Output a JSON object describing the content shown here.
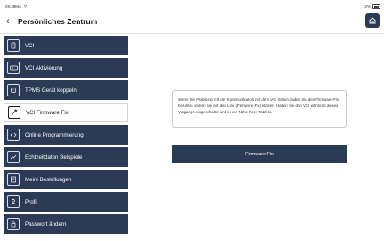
{
  "status_bar": {
    "time": "09:39MA",
    "battery_pct": "72%"
  },
  "header": {
    "back_icon": "chevron-left-icon",
    "title": "Persönliches Zentrum",
    "home_icon": "home-icon"
  },
  "sidebar": {
    "items": [
      {
        "label": "VCI",
        "icon": "vci-device-icon",
        "active": false
      },
      {
        "label": "VCI Aktivierung",
        "icon": "vci-activation-icon",
        "active": false
      },
      {
        "label": "TPMS Gerät koppeln",
        "icon": "tpms-icon",
        "active": false
      },
      {
        "label": "VCI Firmware Fix",
        "icon": "wrench-icon",
        "active": true
      },
      {
        "label": "Online Programmierung",
        "icon": "code-icon",
        "active": false
      },
      {
        "label": "Echtzeitdaten Beispiele",
        "icon": "chart-icon",
        "active": false
      },
      {
        "label": "Meini Bestellungen",
        "icon": "orders-icon",
        "active": false
      },
      {
        "label": "Profil",
        "icon": "user-icon",
        "active": false
      },
      {
        "label": "Passwort ändern",
        "icon": "lock-icon",
        "active": false
      }
    ]
  },
  "main": {
    "info_text": "Wenn Sie Probleme mit der Kommunikation mit dem VCI haben, laden Sie den Firmware-Fix herunter, indem Sie auf den Link (Firmware-Fix) klicken. Halten Sie den VCI während dieses Vorgangs eingeschaltet und in der Nähe Ihres Tablets.",
    "button_label": "Firmware Fix"
  }
}
